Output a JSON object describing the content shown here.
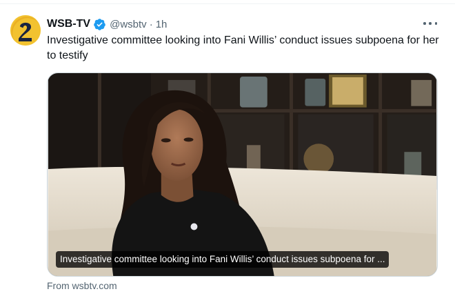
{
  "tweet": {
    "author_name": "WSB-TV",
    "handle": "@wsbtv",
    "separator": "·",
    "time": "1h",
    "text": "Investigative committee looking into Fani Willis’ conduct issues subpoena for her to testify",
    "verified": true
  },
  "card": {
    "caption": "Investigative committee looking into Fani Willis’ conduct issues subpoena for ...",
    "source": "From wsbtv.com"
  },
  "icons": {
    "avatar": "wsb-channel-2-logo",
    "verified": "verified-badge-icon",
    "more": "more-options-icon"
  },
  "colors": {
    "text_primary": "#0f1419",
    "text_secondary": "#536471",
    "verified_blue": "#1d9bf0",
    "logo_yellow": "#f2c230"
  }
}
